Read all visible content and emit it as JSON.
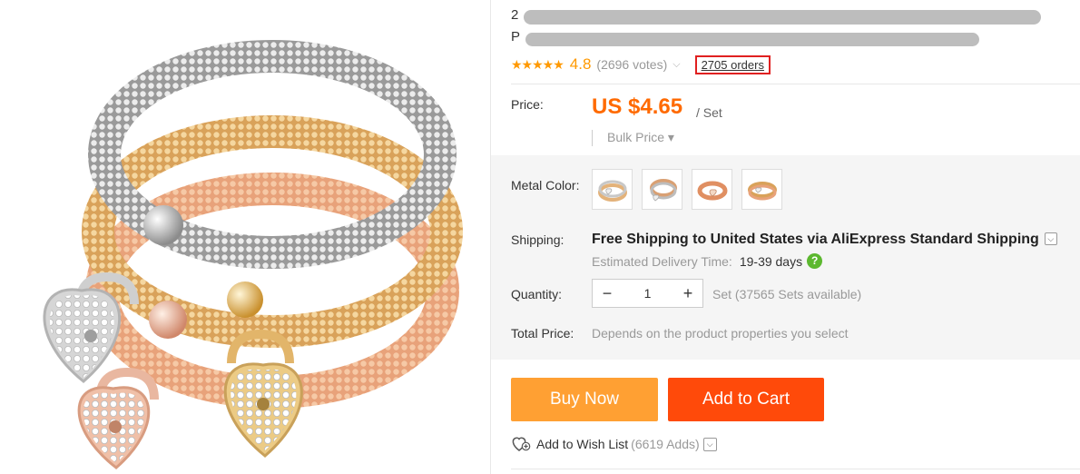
{
  "product": {
    "title_line1": "2",
    "title_line2": "P",
    "rating": {
      "stars": "★★★★★",
      "value": "4.8",
      "votes": "(2696 votes)",
      "orders": "2705 orders"
    },
    "price": {
      "label": "Price:",
      "amount": "US $4.65",
      "unit": "/ Set",
      "bulk": "Bulk Price ▾"
    },
    "metal_color": {
      "label": "Metal Color:",
      "swatch_count": 4
    },
    "shipping": {
      "label": "Shipping:",
      "method": "Free Shipping to United States via AliExpress Standard Shipping",
      "delivery_label": "Estimated Delivery Time:",
      "delivery_days": "19-39 days"
    },
    "quantity": {
      "label": "Quantity:",
      "minus": "−",
      "value": "1",
      "plus": "+",
      "available": "Set (37565 Sets available)"
    },
    "total": {
      "label": "Total Price:",
      "value": "Depends on the product properties you select"
    },
    "buttons": {
      "buy_now": "Buy Now",
      "add_to_cart": "Add to Cart"
    },
    "wishlist": {
      "label": "Add to Wish List",
      "count": "(6619 Adds)"
    }
  },
  "colors": {
    "accent_orange": "#ff6a00",
    "buy_now": "#ffa033",
    "add_to_cart": "#ff4a0a",
    "star": "#ff9900",
    "orders_highlight": "#e02020"
  },
  "icons": {
    "help": "question-circle-icon",
    "heart": "heart-plus-icon",
    "dropdown": "chevron-down-icon"
  }
}
